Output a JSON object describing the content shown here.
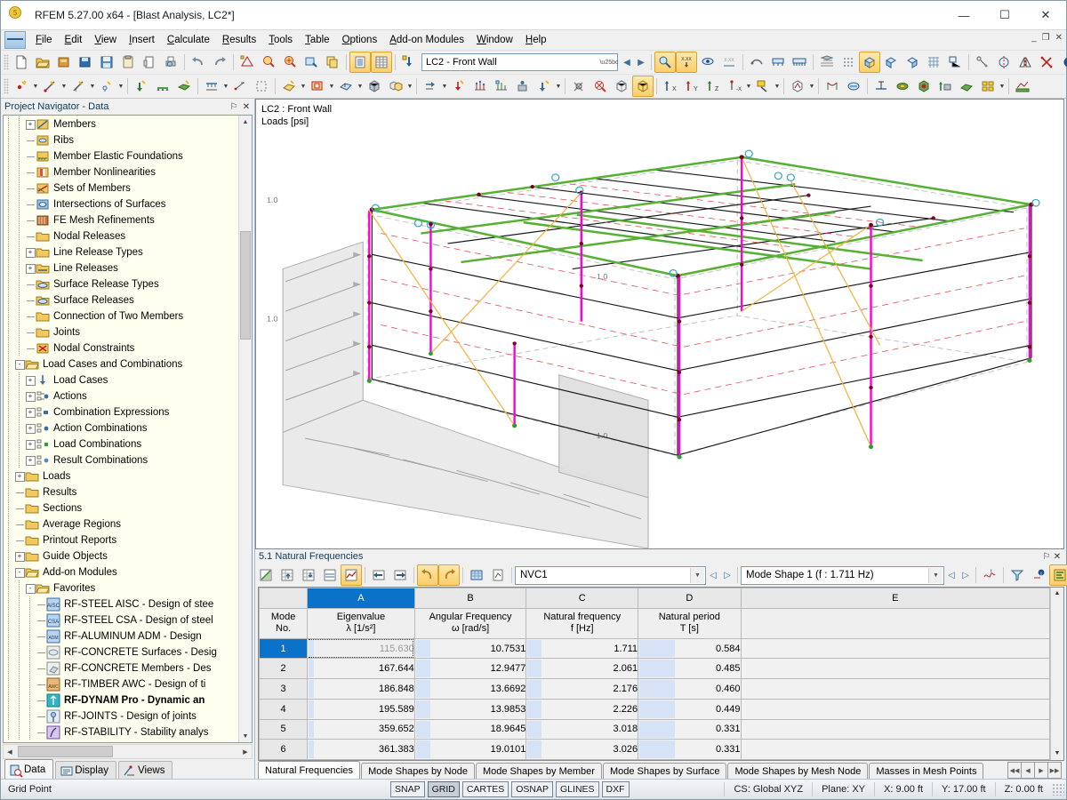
{
  "window": {
    "title": "RFEM 5.27.00 x64 - [Blast Analysis, LC2*]",
    "minimize": "—",
    "maximize": "☐",
    "close": "✕",
    "mdi_minimize": "_",
    "mdi_restore": "❐",
    "mdi_close": "✕"
  },
  "menu": {
    "items": [
      "File",
      "Edit",
      "View",
      "Insert",
      "Calculate",
      "Results",
      "Tools",
      "Table",
      "Options",
      "Add-on Modules",
      "Window",
      "Help"
    ]
  },
  "toolbar1": {
    "load_case": "LC2 - Front Wall",
    "prev": "◀",
    "next": "▶",
    "icons": [
      "new-file-icon",
      "open-folder-icon",
      "open-project-icon",
      "save-project-icon",
      "save-icon",
      "clipboard-icon",
      "print-preview-icon",
      "printer-icon",
      "undo-icon",
      "redo-icon",
      "render-icon",
      "zoom-search-icon",
      "zoom-target-icon",
      "select-window-icon",
      "copy-box-icon",
      "table-view-icon",
      "table-grid-icon",
      "load-case-icon"
    ]
  },
  "toolbar2": {
    "icons": [
      "node-icon",
      "line-icon",
      "member-icon",
      "support-icon",
      "nodal-support-icon",
      "line-support-icon",
      "surface-icon",
      "member-load-icon",
      "member-eccentricity-icon",
      "mesh-icon",
      "solid-icon",
      "opening-icon",
      "thickness-icon",
      "surface-load-icon",
      "free-load-icon",
      "imperfection-icon",
      "hinge-icon",
      "nodal-release-icon",
      "line-release-icon",
      "cross-section-icon",
      "nodal-mass-icon",
      "render-mode-icon",
      "wireframe-icon",
      "solid-model-icon",
      "axis-x-icon",
      "axis-y-icon",
      "axis-z-icon",
      "axis-negx-icon",
      "colors-icon",
      "view-cube-icon",
      "deformation-icon",
      "result-icon",
      "isoline-icon",
      "isosurface-icon",
      "result-diagram-icon",
      "section-icon",
      "result-grid-icon",
      "graph-icon"
    ]
  },
  "navigator": {
    "title": "Project Navigator - Data",
    "pin": "⚐",
    "close": "✕",
    "tree": [
      {
        "label": "Members",
        "indent": 3,
        "expander": "+",
        "icon": "members-icon"
      },
      {
        "label": "Ribs",
        "indent": 3,
        "expander": "",
        "icon": "ribs-icon"
      },
      {
        "label": "Member Elastic Foundations",
        "indent": 3,
        "expander": "",
        "icon": "foundation-icon"
      },
      {
        "label": "Member Nonlinearities",
        "indent": 3,
        "expander": "",
        "icon": "nonlinearity-icon"
      },
      {
        "label": "Sets of Members",
        "indent": 3,
        "expander": "",
        "icon": "sets-icon"
      },
      {
        "label": "Intersections of Surfaces",
        "indent": 3,
        "expander": "",
        "icon": "intersection-icon"
      },
      {
        "label": "FE Mesh Refinements",
        "indent": 3,
        "expander": "",
        "icon": "mesh-refinement-icon"
      },
      {
        "label": "Nodal Releases",
        "indent": 3,
        "expander": "",
        "icon": "folder-icon"
      },
      {
        "label": "Line Release Types",
        "indent": 3,
        "expander": "+",
        "icon": "folder-icon"
      },
      {
        "label": "Line Releases",
        "indent": 3,
        "expander": "+",
        "icon": "line-release-icon"
      },
      {
        "label": "Surface Release Types",
        "indent": 3,
        "expander": "",
        "icon": "surface-release-icon"
      },
      {
        "label": "Surface Releases",
        "indent": 3,
        "expander": "",
        "icon": "surface-release-icon"
      },
      {
        "label": "Connection of Two Members",
        "indent": 3,
        "expander": "",
        "icon": "folder-icon"
      },
      {
        "label": "Joints",
        "indent": 3,
        "expander": "",
        "icon": "folder-icon"
      },
      {
        "label": "Nodal Constraints",
        "indent": 3,
        "expander": "",
        "icon": "constraint-icon"
      },
      {
        "label": "Load Cases and Combinations",
        "indent": 2,
        "expander": "-",
        "icon": "folder-open-icon"
      },
      {
        "label": "Load Cases",
        "indent": 3,
        "expander": "+",
        "icon": "load-case-icon"
      },
      {
        "label": "Actions",
        "indent": 3,
        "expander": "+",
        "icon": "action-icon"
      },
      {
        "label": "Combination Expressions",
        "indent": 3,
        "expander": "+",
        "icon": "combination-icon"
      },
      {
        "label": "Action Combinations",
        "indent": 3,
        "expander": "+",
        "icon": "action-combination-icon"
      },
      {
        "label": "Load Combinations",
        "indent": 3,
        "expander": "+",
        "icon": "load-combination-icon"
      },
      {
        "label": "Result Combinations",
        "indent": 3,
        "expander": "+",
        "icon": "result-combination-icon"
      },
      {
        "label": "Loads",
        "indent": 2,
        "expander": "+",
        "icon": "folder-icon"
      },
      {
        "label": "Results",
        "indent": 2,
        "expander": "",
        "icon": "folder-icon"
      },
      {
        "label": "Sections",
        "indent": 2,
        "expander": "",
        "icon": "folder-icon"
      },
      {
        "label": "Average Regions",
        "indent": 2,
        "expander": "",
        "icon": "folder-icon"
      },
      {
        "label": "Printout Reports",
        "indent": 2,
        "expander": "",
        "icon": "folder-icon"
      },
      {
        "label": "Guide Objects",
        "indent": 2,
        "expander": "+",
        "icon": "folder-icon"
      },
      {
        "label": "Add-on Modules",
        "indent": 2,
        "expander": "-",
        "icon": "folder-open-icon"
      },
      {
        "label": "Favorites",
        "indent": 3,
        "expander": "-",
        "icon": "folder-open-icon"
      },
      {
        "label": "RF-STEEL AISC - Design of stee",
        "indent": 4,
        "expander": "",
        "icon": "rf-steel-aisc-icon"
      },
      {
        "label": "RF-STEEL CSA - Design of steel",
        "indent": 4,
        "expander": "",
        "icon": "rf-steel-csa-icon"
      },
      {
        "label": "RF-ALUMINUM ADM - Design",
        "indent": 4,
        "expander": "",
        "icon": "rf-aluminum-adm-icon"
      },
      {
        "label": "RF-CONCRETE Surfaces - Desig",
        "indent": 4,
        "expander": "",
        "icon": "rf-concrete-surfaces-icon"
      },
      {
        "label": "RF-CONCRETE Members - Des",
        "indent": 4,
        "expander": "",
        "icon": "rf-concrete-members-icon"
      },
      {
        "label": "RF-TIMBER AWC - Design of ti",
        "indent": 4,
        "expander": "",
        "icon": "rf-timber-awc-icon"
      },
      {
        "label": "RF-DYNAM Pro - Dynamic an",
        "indent": 4,
        "expander": "",
        "icon": "rf-dynam-pro-icon",
        "bold": true
      },
      {
        "label": "RF-JOINTS - Design of joints",
        "indent": 4,
        "expander": "",
        "icon": "rf-joints-icon"
      },
      {
        "label": "RF-STABILITY - Stability analys",
        "indent": 4,
        "expander": "",
        "icon": "rf-stability-icon"
      }
    ],
    "tabs": [
      {
        "label": "Data",
        "icon": "data-icon",
        "selected": true
      },
      {
        "label": "Display",
        "icon": "display-icon",
        "selected": false
      },
      {
        "label": "Views",
        "icon": "views-icon",
        "selected": false
      }
    ]
  },
  "viewport": {
    "label_line1": "LC2 : Front Wall",
    "label_line2": "Loads [psi]",
    "load_values": [
      "1.0",
      "1.0",
      "1.0",
      "1.0"
    ],
    "colors": {
      "top_beams": "#55b033",
      "columns": "#ff00d4",
      "members": "#000000",
      "diagonals": "#f5b03c",
      "load_surface": "#e8e8e8",
      "node": "#7a0026"
    }
  },
  "table": {
    "title": "5.1 Natural Frequencies",
    "pin": "⚐",
    "close": "✕",
    "nvc_combo": "NVC1",
    "mode_combo": "Mode Shape 1 (f : 1.711 Hz)",
    "prev": "◁",
    "next": "▷",
    "toolbar_icons": [
      "new-table-icon",
      "insert-row-icon",
      "insert-column-icon",
      "edit-row-icon",
      "results-table-icon",
      "move-left-icon",
      "move-right-icon",
      "undo-table-icon",
      "redo-table-icon",
      "grid-settings-icon",
      "export-table-icon",
      "chart-icon",
      "filter-icon",
      "info-icon",
      "color-table-icon",
      "excel-export-icon"
    ],
    "column_letters": [
      "A",
      "B",
      "C",
      "D",
      "E"
    ],
    "row_header": {
      "line1": "Mode",
      "line2": "No."
    },
    "columns": [
      {
        "letter": "A",
        "name": "Eigenvalue",
        "unit": "λ [1/s²]",
        "selected": true
      },
      {
        "letter": "B",
        "name": "Angular Frequency",
        "unit": "ω [rad/s]",
        "selected": false
      },
      {
        "letter": "C",
        "name": "Natural frequency",
        "unit": "f [Hz]",
        "selected": false
      },
      {
        "letter": "D",
        "name": "Natural period",
        "unit": "T [s]",
        "selected": false
      },
      {
        "letter": "E",
        "name": "",
        "unit": "",
        "selected": false
      }
    ],
    "rows": [
      {
        "mode": "1",
        "eigenvalue": "115.630",
        "angular": "10.7531",
        "freq": "1.711",
        "period": "0.584",
        "selected": true
      },
      {
        "mode": "2",
        "eigenvalue": "167.644",
        "angular": "12.9477",
        "freq": "2.061",
        "period": "0.485",
        "selected": false
      },
      {
        "mode": "3",
        "eigenvalue": "186.848",
        "angular": "13.6692",
        "freq": "2.176",
        "period": "0.460",
        "selected": false
      },
      {
        "mode": "4",
        "eigenvalue": "195.589",
        "angular": "13.9853",
        "freq": "2.226",
        "period": "0.449",
        "selected": false
      },
      {
        "mode": "5",
        "eigenvalue": "359.652",
        "angular": "18.9645",
        "freq": "3.018",
        "period": "0.331",
        "selected": false
      },
      {
        "mode": "6",
        "eigenvalue": "361.383",
        "angular": "19.0101",
        "freq": "3.026",
        "period": "0.331",
        "selected": false
      }
    ],
    "tabs": [
      {
        "label": "Natural Frequencies",
        "selected": true
      },
      {
        "label": "Mode Shapes by Node",
        "selected": false
      },
      {
        "label": "Mode Shapes by Member",
        "selected": false
      },
      {
        "label": "Mode Shapes by Surface",
        "selected": false
      },
      {
        "label": "Mode Shapes by Mesh Node",
        "selected": false
      },
      {
        "label": "Masses in Mesh Points",
        "selected": false
      }
    ],
    "tab_nav": [
      "⏮",
      "◀",
      "▶",
      "⏭"
    ]
  },
  "statusbar": {
    "message": "Grid Point",
    "toggles": [
      {
        "label": "SNAP",
        "on": false
      },
      {
        "label": "GRID",
        "on": true
      },
      {
        "label": "CARTES",
        "on": false
      },
      {
        "label": "OSNAP",
        "on": false
      },
      {
        "label": "GLINES",
        "on": false
      },
      {
        "label": "DXF",
        "on": false
      }
    ],
    "cs": "CS: Global XYZ",
    "plane": "Plane: XY",
    "x": "X: 9.00 ft",
    "y": "Y: 17.00 ft",
    "z": "Z: 0.00 ft"
  }
}
